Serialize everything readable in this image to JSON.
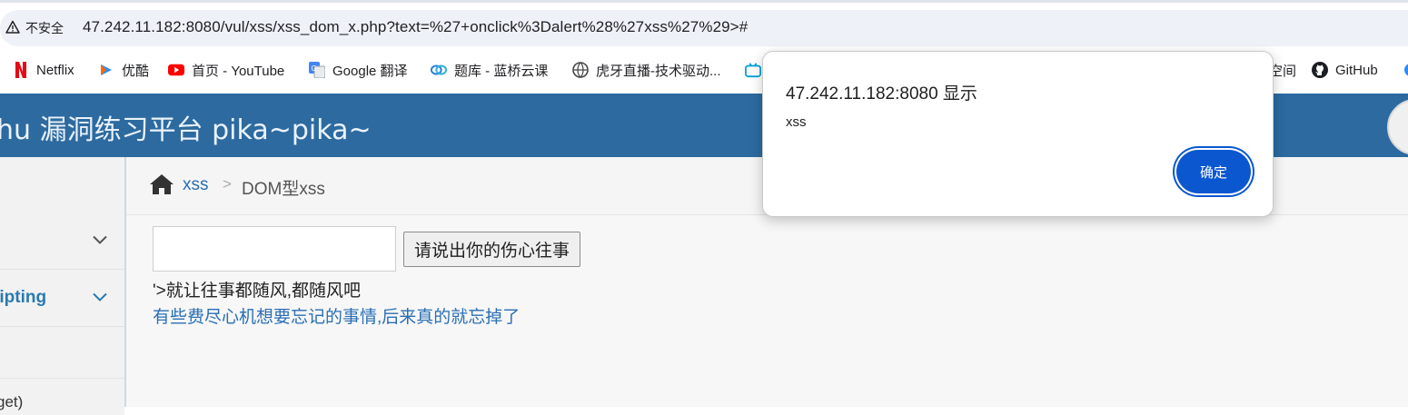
{
  "browser": {
    "security_label": "不安全",
    "url": "47.242.11.182:8080/vul/xss/xss_dom_x.php?text=%27+onclick%3Dalert%28%27xss%27%29>#"
  },
  "bookmarks": [
    {
      "label": "Netflix",
      "icon": "netflix-icon"
    },
    {
      "label": "优酷",
      "icon": "youku-icon"
    },
    {
      "label": "首页 - YouTube",
      "icon": "youtube-icon"
    },
    {
      "label": "Google 翻译",
      "icon": "google-translate-icon"
    },
    {
      "label": "题库 - 蓝桥云课",
      "icon": "lanqiao-icon"
    },
    {
      "label": "虎牙直播-技术驱动...",
      "icon": "huya-icon"
    },
    {
      "label": "空间",
      "icon": "bookmark-icon"
    },
    {
      "label": "GitHub",
      "icon": "github-icon"
    }
  ],
  "app": {
    "brand": "hu 漏洞练习平台 pika~pika~"
  },
  "sidebar": {
    "items": [
      {
        "label": "",
        "expanded": false
      },
      {
        "label": "ripting",
        "expanded": false
      },
      {
        "label": ""
      },
      {
        "label": "get)"
      }
    ]
  },
  "breadcrumb": {
    "parent": "xss",
    "separator": ">",
    "current": "DOM型xss"
  },
  "form": {
    "input_value": "",
    "submit_label": "请说出你的伤心往事"
  },
  "output": {
    "line": "'>就让往事都随风,都随风吧",
    "link": "有些费尽心机想要忘记的事情,后来真的就忘掉了"
  },
  "alert": {
    "title": "47.242.11.182:8080 显示",
    "message": "xss",
    "ok_label": "确定"
  },
  "colors": {
    "navbar": "#2c6aa0",
    "link": "#2a6fb5",
    "dialog_button": "#0b57d0"
  }
}
